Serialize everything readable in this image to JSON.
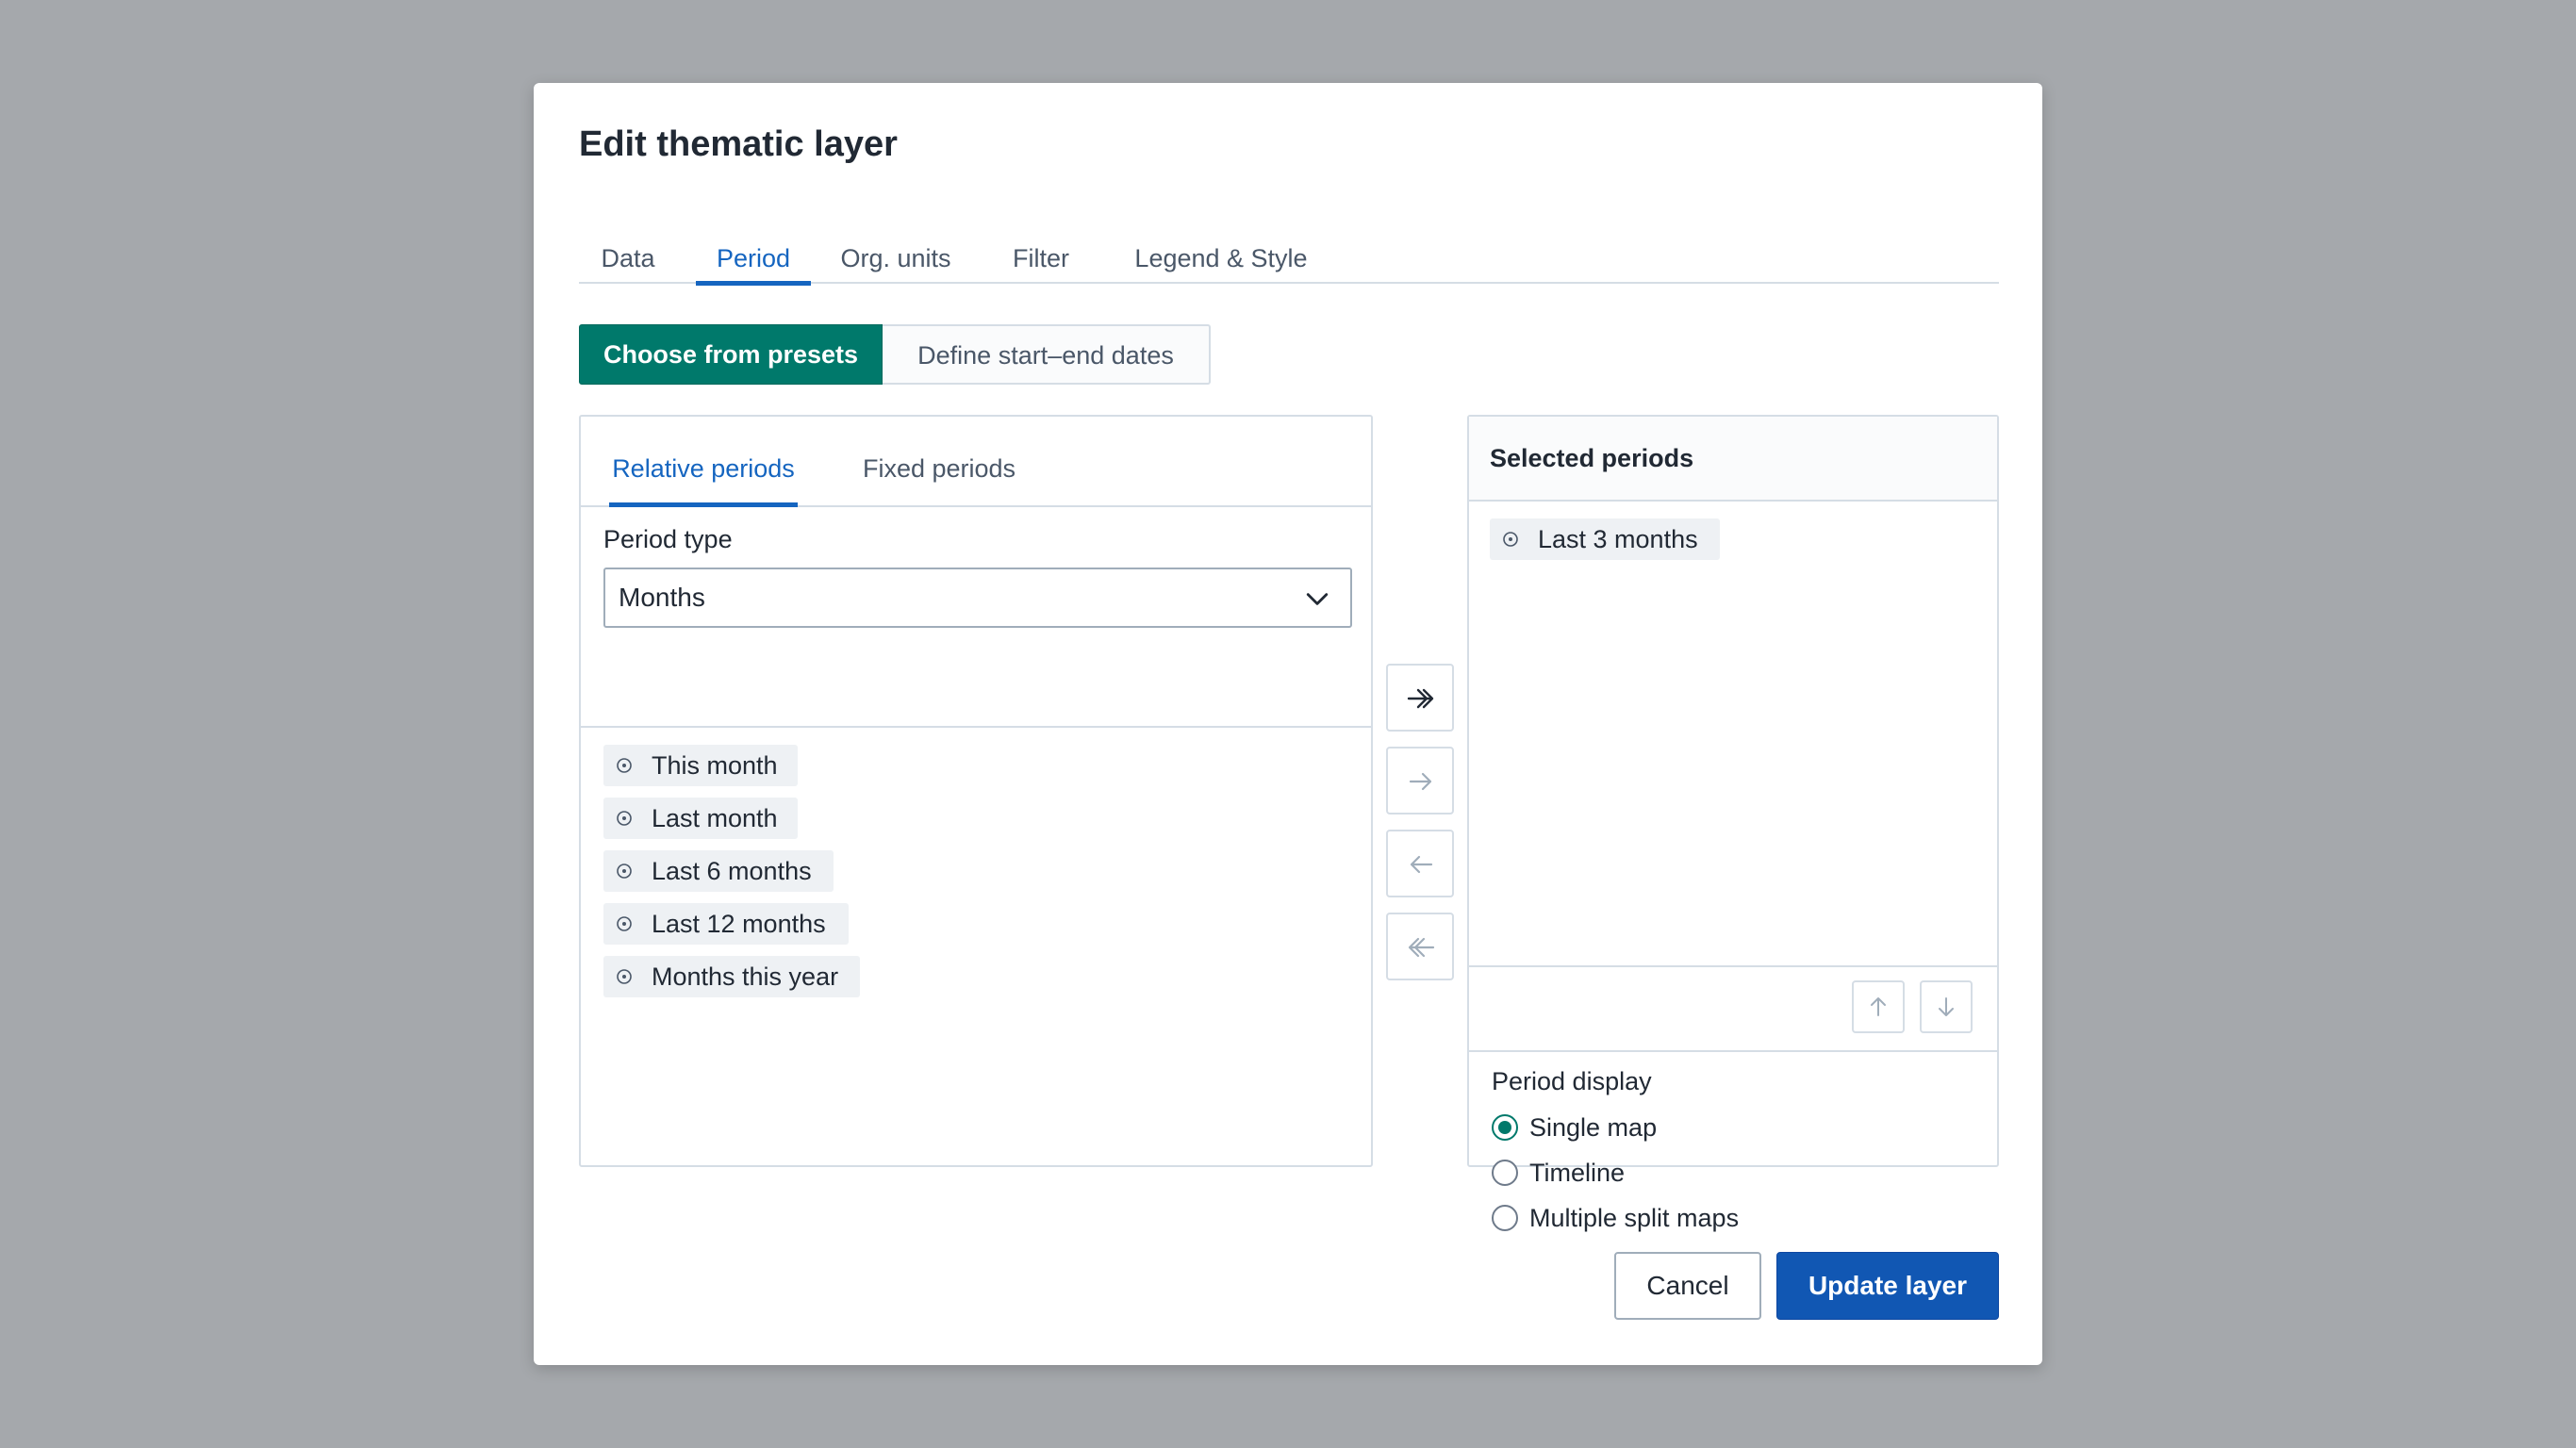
{
  "dialog": {
    "title": "Edit thematic layer",
    "tabs": [
      {
        "label": "Data",
        "active": false
      },
      {
        "label": "Period",
        "active": true
      },
      {
        "label": "Org. units",
        "active": false
      },
      {
        "label": "Filter",
        "active": false
      },
      {
        "label": "Legend & Style",
        "active": false
      }
    ],
    "mode_toggle": {
      "presets_label": "Choose from presets",
      "dates_label": "Define start–end dates",
      "selected": "Choose from presets"
    },
    "available": {
      "subtabs": [
        {
          "label": "Relative periods",
          "active": true
        },
        {
          "label": "Fixed periods",
          "active": false
        }
      ],
      "period_type_label": "Period type",
      "period_type_value": "Months",
      "options": [
        "This month",
        "Last month",
        "Last 6 months",
        "Last 12 months",
        "Months this year"
      ]
    },
    "transfer_buttons": [
      {
        "name": "select-all",
        "icon": "double-arrow-right-icon",
        "enabled": true
      },
      {
        "name": "select-one",
        "icon": "arrow-right-icon",
        "enabled": false
      },
      {
        "name": "deselect-one",
        "icon": "arrow-left-icon",
        "enabled": false
      },
      {
        "name": "deselect-all",
        "icon": "double-arrow-left-icon",
        "enabled": false
      }
    ],
    "selected": {
      "header": "Selected periods",
      "items": [
        "Last 3 months"
      ]
    },
    "period_display": {
      "label": "Period display",
      "options": [
        "Single map",
        "Timeline",
        "Multiple split maps"
      ],
      "selected": "Single map"
    },
    "footer": {
      "cancel_label": "Cancel",
      "update_label": "Update layer"
    },
    "colors": {
      "accent_blue": "#1565c0",
      "toggle_green": "#00796b",
      "primary_button": "#1157b3"
    }
  }
}
